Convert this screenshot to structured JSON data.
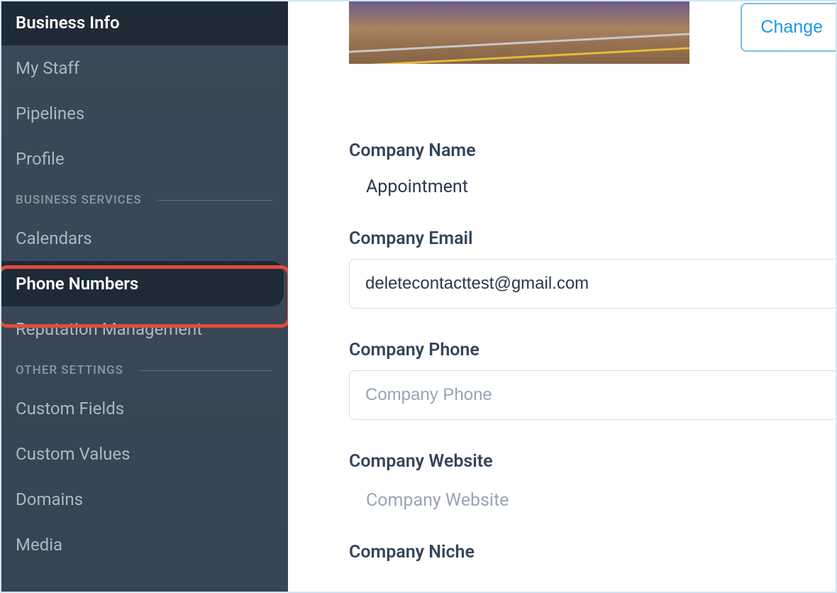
{
  "sidebar": {
    "topItems": [
      {
        "label": "Business Info",
        "active": true
      },
      {
        "label": "My Staff"
      },
      {
        "label": "Pipelines"
      },
      {
        "label": "Profile"
      }
    ],
    "sections": [
      {
        "header": "BUSINESS SERVICES",
        "items": [
          {
            "label": "Calendars"
          },
          {
            "label": "Phone Numbers",
            "active": true,
            "highlighted": true
          },
          {
            "label": "Reputation Management"
          }
        ]
      },
      {
        "header": "OTHER SETTINGS",
        "items": [
          {
            "label": "Custom Fields"
          },
          {
            "label": "Custom Values"
          },
          {
            "label": "Domains"
          },
          {
            "label": "Media"
          }
        ]
      }
    ]
  },
  "main": {
    "changeButton": "Change",
    "fields": {
      "companyName": {
        "label": "Company Name",
        "value": "Appointment"
      },
      "companyEmail": {
        "label": "Company Email",
        "value": "deletecontacttest@gmail.com"
      },
      "companyPhone": {
        "label": "Company Phone",
        "value": "",
        "placeholder": "Company Phone"
      },
      "companyWebsite": {
        "label": "Company Website",
        "value": "",
        "placeholder": "Company Website"
      },
      "companyNiche": {
        "label": "Company Niche"
      }
    }
  }
}
